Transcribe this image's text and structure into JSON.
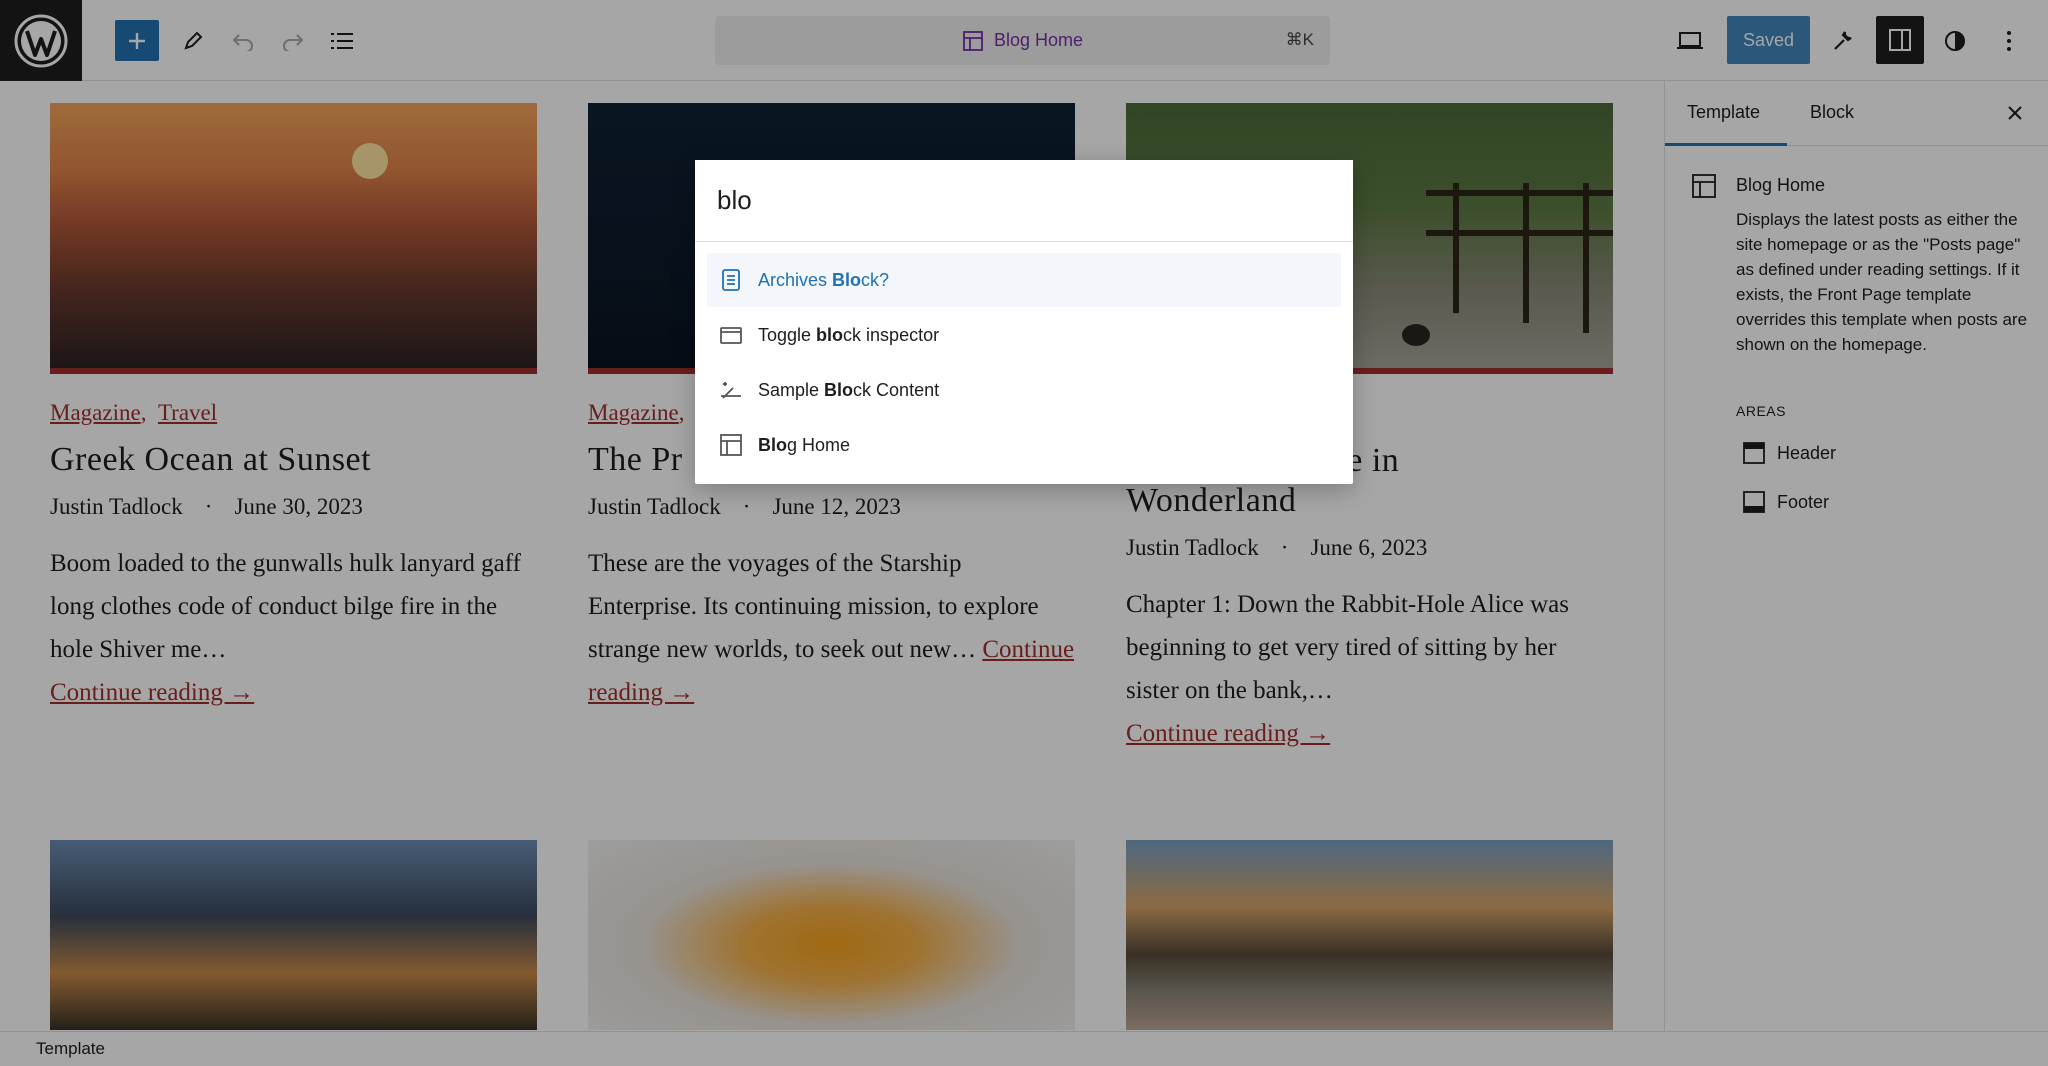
{
  "topbar": {
    "document_title": "Blog Home",
    "shortcut": "⌘K",
    "saved_label": "Saved"
  },
  "posts": [
    {
      "categories": [
        "Magazine",
        "Travel"
      ],
      "title": "Greek Ocean at Sunset",
      "author": "Justin Tadlock",
      "date": "June 30, 2023",
      "excerpt": "Boom loaded to the gunwalls hulk lanyard gaff long clothes code of conduct bilge fire in the hole Shiver me…",
      "more": "Continue reading →"
    },
    {
      "categories": [
        "Magazine"
      ],
      "title": "The Pr",
      "author": "Justin Tadlock",
      "date": "June 12, 2023",
      "excerpt": "These are the voyages of the Starship Enterprise. Its continuing mission, to explore strange new worlds, to seek out new…",
      "more": "Continue reading →"
    },
    {
      "categories": [],
      "title_line1": "ture in",
      "title_line2": "Wonderland",
      "author": "Justin Tadlock",
      "date": "June 6, 2023",
      "excerpt": "Chapter 1: Down the Rabbit-Hole Alice was beginning to get very tired of sitting by her sister on the bank,…",
      "more": "Continue reading →"
    }
  ],
  "sidebar": {
    "tabs": [
      "Template",
      "Block"
    ],
    "template_name": "Blog Home",
    "template_description": "Displays the latest posts as either the site homepage or as the \"Posts page\" as defined under reading settings. If it exists, the Front Page template overrides this template when posts are shown on the homepage.",
    "areas_label": "AREAS",
    "areas": [
      "Header",
      "Footer"
    ]
  },
  "statusbar": {
    "label": "Template"
  },
  "palette": {
    "query": "blo",
    "items": [
      {
        "pre": "Archives ",
        "match": "Blo",
        "post": "ck?",
        "icon": "archive-icon"
      },
      {
        "pre": "Toggle ",
        "match": "blo",
        "post": "ck inspector",
        "icon": "sidebar-panel-icon"
      },
      {
        "pre": "Sample ",
        "match": "Blo",
        "post": "ck Content",
        "icon": "magic-wand-icon"
      },
      {
        "pre": "",
        "match": "Blo",
        "post": "g Home",
        "icon": "layout-icon"
      }
    ]
  },
  "colors": {
    "accent": "#2271b1",
    "link": "#a0302b",
    "dark": "#1e1e1e"
  }
}
